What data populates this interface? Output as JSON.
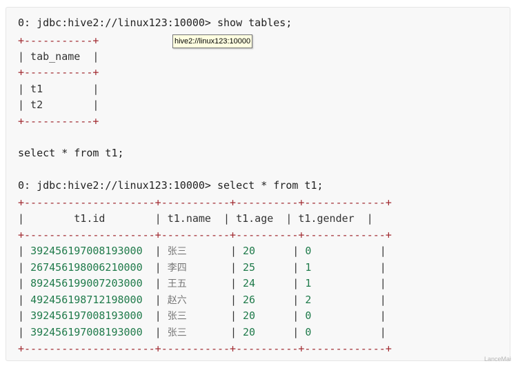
{
  "prompt_line_1": "0: jdbc:hive2://linux123:10000> show tables;",
  "tooltip_text": "hive2://linux123:10000",
  "tables_result": {
    "border": "+-----------+",
    "header": "| tab_name  |",
    "rows": [
      "| t1        |",
      "| t2        |"
    ]
  },
  "select_statement": "select * from t1;",
  "prompt_line_2": "0: jdbc:hive2://linux123:10000> select * from t1;",
  "t1_result": {
    "border": "+---------------------+-----------+----------+-------------+",
    "header": "|        t1.id        | t1.name  | t1.age  | t1.gender  |",
    "rows": [
      {
        "id": "392456197008193000",
        "name": "张三",
        "age": "20",
        "gender": "0"
      },
      {
        "id": "267456198006210000",
        "name": "李四",
        "age": "25",
        "gender": "1"
      },
      {
        "id": "892456199007203000",
        "name": "王五",
        "age": "24",
        "gender": "1"
      },
      {
        "id": "492456198712198000",
        "name": "赵六",
        "age": "26",
        "gender": "2"
      },
      {
        "id": "392456197008193000",
        "name": "张三",
        "age": "20",
        "gender": "0"
      },
      {
        "id": "392456197008193000",
        "name": "张三",
        "age": "20",
        "gender": "0"
      }
    ]
  },
  "watermark": "LanceMai"
}
